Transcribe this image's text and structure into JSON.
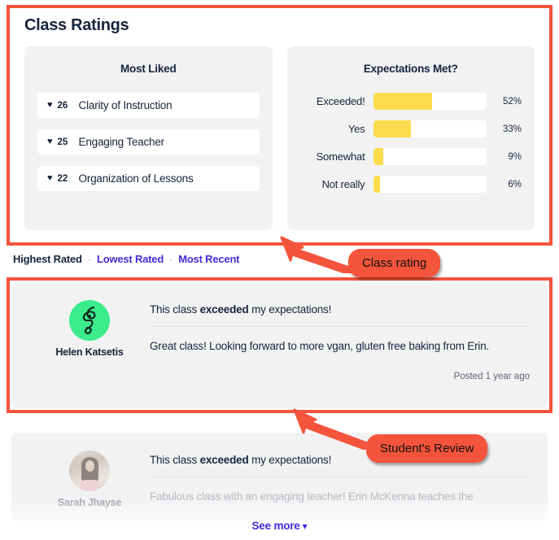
{
  "ratings": {
    "title": "Class Ratings",
    "most_liked": {
      "panel_title": "Most Liked",
      "items": [
        {
          "count": "26",
          "label": "Clarity of Instruction",
          "icon": "heart-icon"
        },
        {
          "count": "25",
          "label": "Engaging Teacher",
          "icon": "heart-icon"
        },
        {
          "count": "22",
          "label": "Organization of Lessons",
          "icon": "heart-icon"
        }
      ]
    },
    "expectations": {
      "panel_title": "Expectations Met?"
    }
  },
  "chart_data": {
    "type": "bar",
    "title": "Expectations Met?",
    "orientation": "horizontal",
    "categories": [
      "Exceeded!",
      "Yes",
      "Somewhat",
      "Not really"
    ],
    "values": [
      52,
      33,
      9,
      6
    ],
    "value_labels": [
      "52%",
      "33%",
      "9%",
      "6%"
    ],
    "xlabel": "",
    "ylabel": "",
    "xlim": [
      0,
      100
    ],
    "grid": false,
    "legend": false,
    "bar_color": "#fcdc4d",
    "track_color": "#ffffff"
  },
  "sort": {
    "options": [
      {
        "label": "Highest Rated",
        "active": true
      },
      {
        "label": "Lowest Rated",
        "active": false
      },
      {
        "label": "Most Recent",
        "active": false
      }
    ],
    "separator": "·"
  },
  "reviews": [
    {
      "author": "Helen Katsetis",
      "avatar": "abstract-face-avatar",
      "headline_pre": "This class ",
      "headline_bold": "exceeded",
      "headline_post": " my expectations!",
      "text": "Great class! Looking forward to more vgan, gluten free baking from Erin.",
      "posted": "Posted 1 year ago"
    },
    {
      "author": "Sarah Jhayse",
      "avatar": "photo-avatar",
      "headline_pre": "This class ",
      "headline_bold": "exceeded",
      "headline_post": " my expectations!",
      "text": "Fabulous class with an engaging teacher! Erin McKenna teaches the",
      "posted": ""
    }
  ],
  "footer": {
    "see_more": "See more",
    "chevron": "⌄"
  },
  "annotations": [
    {
      "label": "Class rating",
      "color": "#f4543c"
    },
    {
      "label": "Student's Review",
      "color": "#f4543c"
    }
  ],
  "colors": {
    "annotation_red": "#f4543c",
    "bar_yellow": "#fcdc4d",
    "link_purple": "#4629d6",
    "text_navy": "#16243d",
    "panel_gray": "#f2f2f3",
    "avatar_green": "#3aec8b"
  }
}
